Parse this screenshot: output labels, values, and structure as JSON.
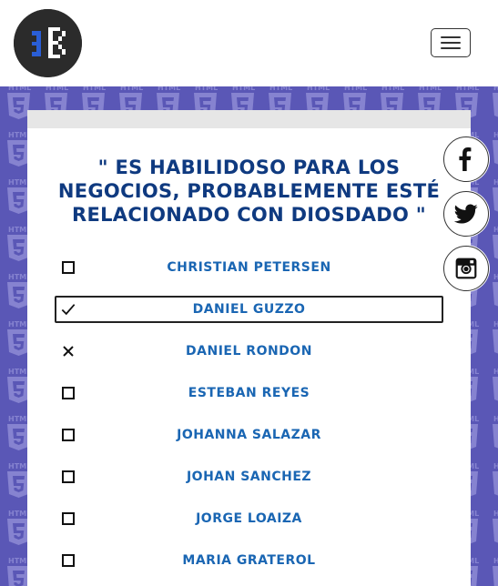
{
  "quote": "\" Es habilidoso para los negocios, probablemente esté relacionado con Diosdado \"",
  "options": [
    {
      "label": "Christian Petersen",
      "state": "unchecked"
    },
    {
      "label": "Daniel Guzzo",
      "state": "checked"
    },
    {
      "label": "Daniel Rondon",
      "state": "wrong"
    },
    {
      "label": "Esteban Reyes",
      "state": "unchecked"
    },
    {
      "label": "Johanna Salazar",
      "state": "unchecked"
    },
    {
      "label": "Johan Sanchez",
      "state": "unchecked"
    },
    {
      "label": "Jorge Loaiza",
      "state": "unchecked"
    },
    {
      "label": "Maria Graterol",
      "state": "unchecked"
    }
  ],
  "social": {
    "icons": [
      "facebook-icon",
      "twitter-icon",
      "instagram-icon"
    ]
  },
  "colors": {
    "pattern_bg": "#5a57b6",
    "quote": "#0f3a80",
    "option_label": "#1a66b3",
    "logo_bg": "#2b2b2b",
    "logo_blue": "#2a5ed6"
  }
}
